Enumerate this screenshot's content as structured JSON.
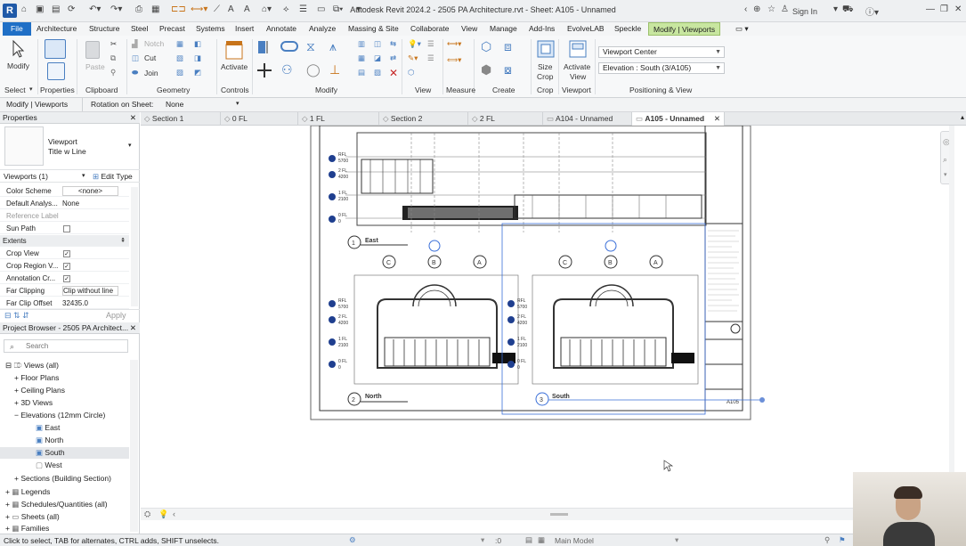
{
  "window": {
    "title": "Autodesk Revit 2024.2 - 2505 PA Architecture.rvt - Sheet: A105 - Unnamed",
    "sign_in": "Sign In",
    "logo": "R"
  },
  "ribbon_tabs": [
    "File",
    "Architecture",
    "Structure",
    "Steel",
    "Precast",
    "Systems",
    "Insert",
    "Annotate",
    "Analyze",
    "Massing & Site",
    "Collaborate",
    "View",
    "Manage",
    "Add-Ins",
    "EvolveLAB",
    "Speckle",
    "Modify | Viewports"
  ],
  "ribbon": {
    "modify": "Modify",
    "notch": "Notch",
    "cut": "Cut",
    "join": "Join",
    "paste": "Paste",
    "activate": "Activate",
    "size_crop_1": "Size",
    "size_crop_2": "Crop",
    "activate_view_1": "Activate",
    "activate_view_2": "View",
    "viewport_type": "Viewport Center",
    "viewport_view": "Elevation : South (3/A105)",
    "panels": [
      "Select",
      "Properties",
      "Clipboard",
      "Geometry",
      "Controls",
      "Modify",
      "View",
      "Measure",
      "Create",
      "Crop",
      "Viewport",
      "Positioning & View"
    ]
  },
  "options_bar": {
    "context": "Modify | Viewports",
    "rotation_label": "Rotation on Sheet:",
    "rotation_value": "None"
  },
  "view_tabs": [
    "Section 1",
    "0 FL",
    "1 FL",
    "Section 2",
    "2 FL",
    "A104 - Unnamed",
    "A105 - Unnamed"
  ],
  "properties": {
    "title": "Properties",
    "type_1": "Viewport",
    "type_2": "Title w Line",
    "selector": "Viewports (1)",
    "edit_type": "Edit Type",
    "rows": [
      {
        "k": "Color Scheme",
        "v": "<none>"
      },
      {
        "k": "Default Analys...",
        "v": "None"
      },
      {
        "k": "Reference Label",
        "v": ""
      },
      {
        "k": "Sun Path",
        "v": ""
      },
      {
        "k": "Extents",
        "v": ""
      },
      {
        "k": "Crop View",
        "v": ""
      },
      {
        "k": "Crop Region V...",
        "v": ""
      },
      {
        "k": "Annotation Cr...",
        "v": ""
      },
      {
        "k": "Far Clipping",
        "v": "Clip without line"
      },
      {
        "k": "Far Clip Offset",
        "v": "32435.0"
      }
    ],
    "apply": "Apply"
  },
  "browser": {
    "title": "Project Browser - 2505 PA Architect...",
    "search_placeholder": "Search",
    "items": [
      "Views (all)",
      "Floor Plans",
      "Ceiling Plans",
      "3D Views",
      "Elevations (12mm Circle)",
      "East",
      "North",
      "South",
      "West",
      "Sections (Building Section)",
      "Legends",
      "Schedules/Quantities (all)",
      "Sheets (all)",
      "Families"
    ]
  },
  "sheet": {
    "levels_top": [
      {
        "name": "RFL",
        "elev": "5700"
      },
      {
        "name": "2 FL",
        "elev": "4200"
      },
      {
        "name": "1 FL",
        "elev": "2100"
      },
      {
        "name": "0 FL",
        "elev": "0"
      }
    ],
    "grids": [
      "C",
      "B",
      "A"
    ],
    "view_1": {
      "num": "1",
      "name": "East"
    },
    "view_2": {
      "num": "2",
      "name": "North"
    },
    "view_3": {
      "num": "3",
      "name": "South"
    },
    "sheet_number": "A105"
  },
  "status": {
    "text": "Click to select, TAB for alternates, CTRL adds, SHIFT unselects.",
    "scale": ":0",
    "model": "Main Model"
  }
}
